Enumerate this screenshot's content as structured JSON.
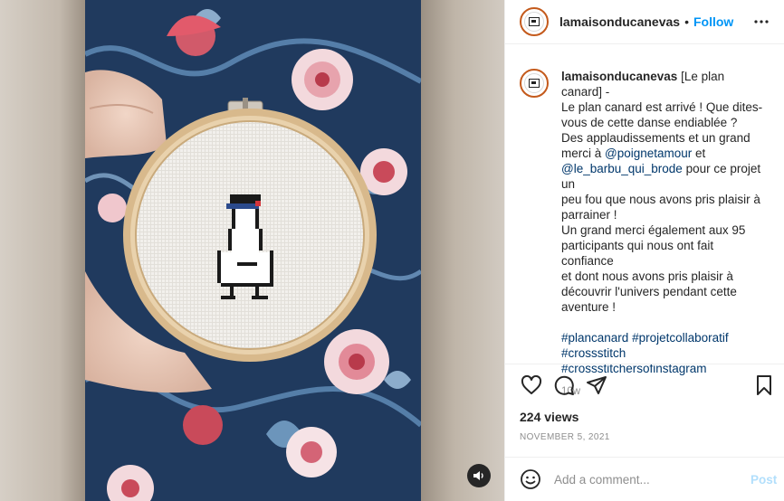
{
  "post": {
    "username": "lamaisonducanevas",
    "separator": "•",
    "follow_label": "Follow"
  },
  "caption": {
    "username": "lamaisonducanevas",
    "lines": [
      " [Le plan canard] -",
      "Le plan canard est arrivé ! Que dites-",
      "vous de cette danse endiablée ?",
      "Des applaudissements et un grand",
      "merci à ",
      "@poignetamour",
      " et",
      "@le_barbu_qui_brode",
      " pour ce projet un",
      "peu fou que nous avons pris plaisir à",
      "parrainer !",
      "Un grand merci également aux 95",
      "participants qui nous ont fait confiance",
      "et dont nous avons pris plaisir à",
      "découvrir l'univers pendant cette",
      "aventure !"
    ],
    "hashtags": [
      "#plancanard",
      "#projetcollaboratif",
      "#crossstitch",
      "#crossstitchersofinstagram"
    ],
    "time_ago": "10w"
  },
  "actions": {
    "like_icon": "heart-icon",
    "comment_icon": "comment-icon",
    "share_icon": "paper-plane-icon",
    "save_icon": "bookmark-icon"
  },
  "stats": {
    "views": "224 views",
    "date": "NOVEMBER 5, 2021"
  },
  "comment": {
    "placeholder": "Add a comment...",
    "post_label": "Post",
    "emoji_icon": "smiley-icon"
  },
  "media": {
    "mute_icon": "speaker-icon"
  },
  "colors": {
    "accent": "#0095f6",
    "link": "#00376b",
    "muted": "#8e8e8e",
    "post_disabled": "#b2dffc",
    "avatar_ring": "#c45a1c"
  }
}
